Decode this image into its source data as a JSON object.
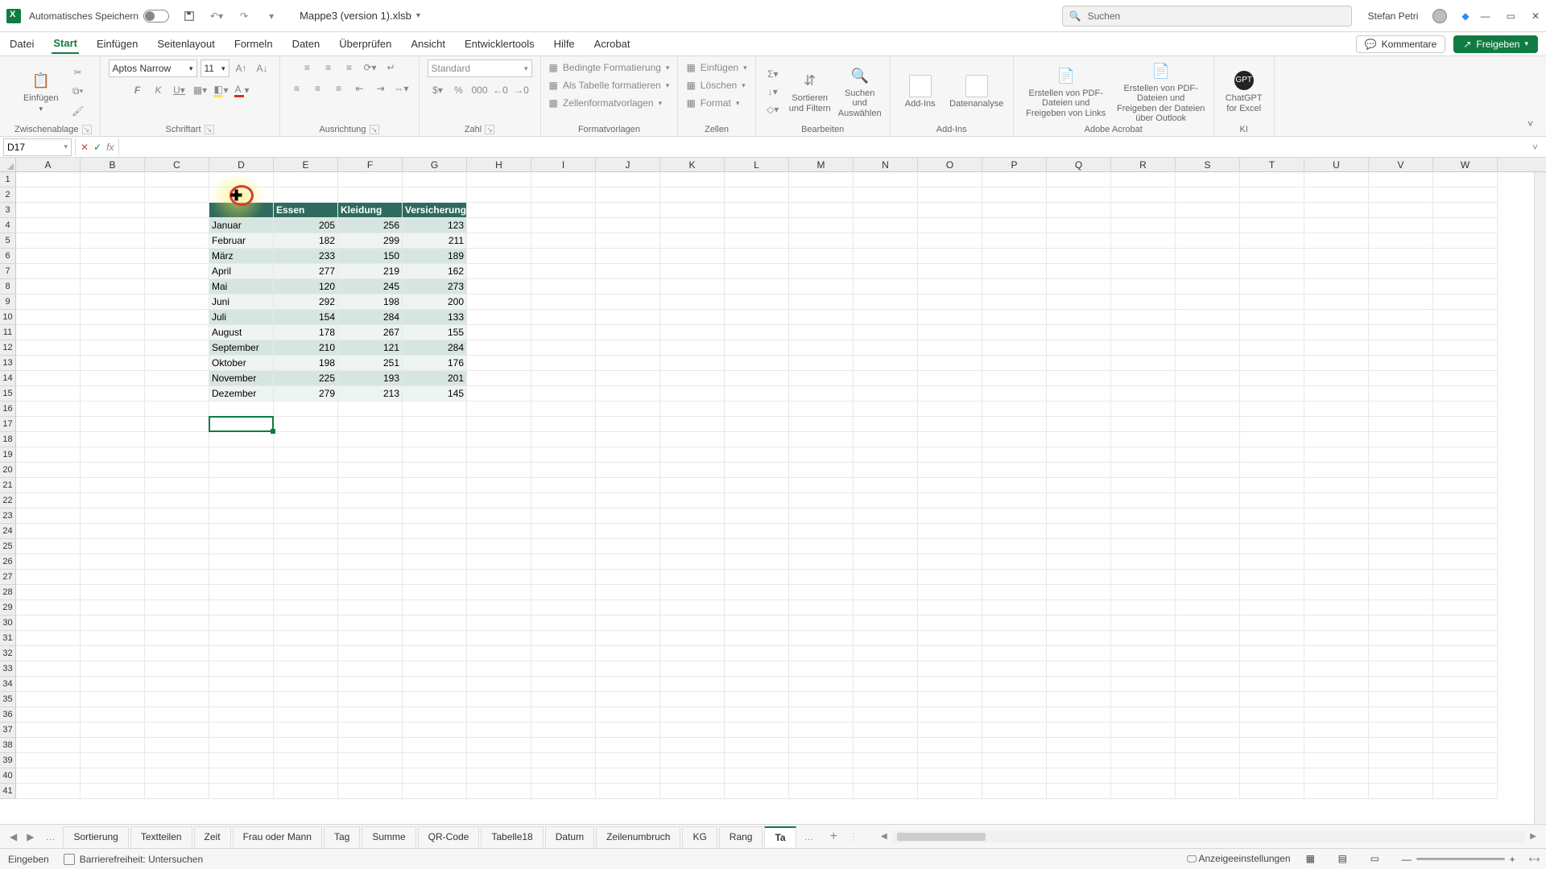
{
  "titlebar": {
    "autosave": "Automatisches Speichern",
    "doc_title": "Mappe3 (version 1).xlsb",
    "search_placeholder": "Suchen",
    "user": "Stefan Petri"
  },
  "tabs": {
    "items": [
      "Datei",
      "Start",
      "Einfügen",
      "Seitenlayout",
      "Formeln",
      "Daten",
      "Überprüfen",
      "Ansicht",
      "Entwicklertools",
      "Hilfe",
      "Acrobat"
    ],
    "comments": "Kommentare",
    "share": "Freigeben"
  },
  "ribbon": {
    "clipboard_label": "Zwischenablage",
    "paste": "Einfügen",
    "font_label": "Schriftart",
    "font_name": "Aptos Narrow",
    "font_size": "11",
    "alignment_label": "Ausrichtung",
    "number_label": "Zahl",
    "number_format": "Standard",
    "styles_label": "Formatvorlagen",
    "cond_fmt": "Bedingte Formatierung",
    "as_table": "Als Tabelle formatieren",
    "cell_styles": "Zellenformatvorlagen",
    "cells_label": "Zellen",
    "insert": "Einfügen",
    "delete": "Löschen",
    "format": "Format",
    "editing_label": "Bearbeiten",
    "sort_filter": "Sortieren und Filtern",
    "find_select": "Suchen und Auswählen",
    "addins_label": "Add-Ins",
    "addins": "Add-Ins",
    "analyze": "Datenanalyse",
    "acrobat_label": "Adobe Acrobat",
    "acrobat1": "Erstellen von PDF-Dateien und Freigeben von Links",
    "acrobat2": "Erstellen von PDF-Dateien und Freigeben der Dateien über Outlook",
    "ki_label": "KI",
    "chatgpt": "ChatGPT for Excel"
  },
  "fx": {
    "name_box": "D17"
  },
  "columns": [
    "A",
    "B",
    "C",
    "D",
    "E",
    "F",
    "G",
    "H",
    "I",
    "J",
    "K",
    "L",
    "M",
    "N",
    "O",
    "P",
    "Q",
    "R",
    "S",
    "T",
    "U",
    "V",
    "W"
  ],
  "chart_data": {
    "type": "table",
    "title": "",
    "columns": [
      "",
      "Essen",
      "Kleidung",
      "Versicherung"
    ],
    "rows": [
      [
        "Januar",
        205,
        256,
        123
      ],
      [
        "Februar",
        182,
        299,
        211
      ],
      [
        "März",
        233,
        150,
        189
      ],
      [
        "April",
        277,
        219,
        162
      ],
      [
        "Mai",
        120,
        245,
        273
      ],
      [
        "Juni",
        292,
        198,
        200
      ],
      [
        "Juli",
        154,
        284,
        133
      ],
      [
        "August",
        178,
        267,
        155
      ],
      [
        "September",
        210,
        121,
        284
      ],
      [
        "Oktober",
        198,
        251,
        176
      ],
      [
        "November",
        225,
        193,
        201
      ],
      [
        "Dezember",
        279,
        213,
        145
      ]
    ]
  },
  "sheet_tabs": [
    "Sortierung",
    "Textteilen",
    "Zeit",
    "Frau oder Mann",
    "Tag",
    "Summe",
    "QR-Code",
    "Tabelle18",
    "Datum",
    "Zeilenumbruch",
    "KG",
    "Rang",
    "Ta"
  ],
  "status": {
    "mode": "Eingeben",
    "accessibility": "Barrierefreiheit: Untersuchen",
    "display_settings": "Anzeigeeinstellungen"
  }
}
